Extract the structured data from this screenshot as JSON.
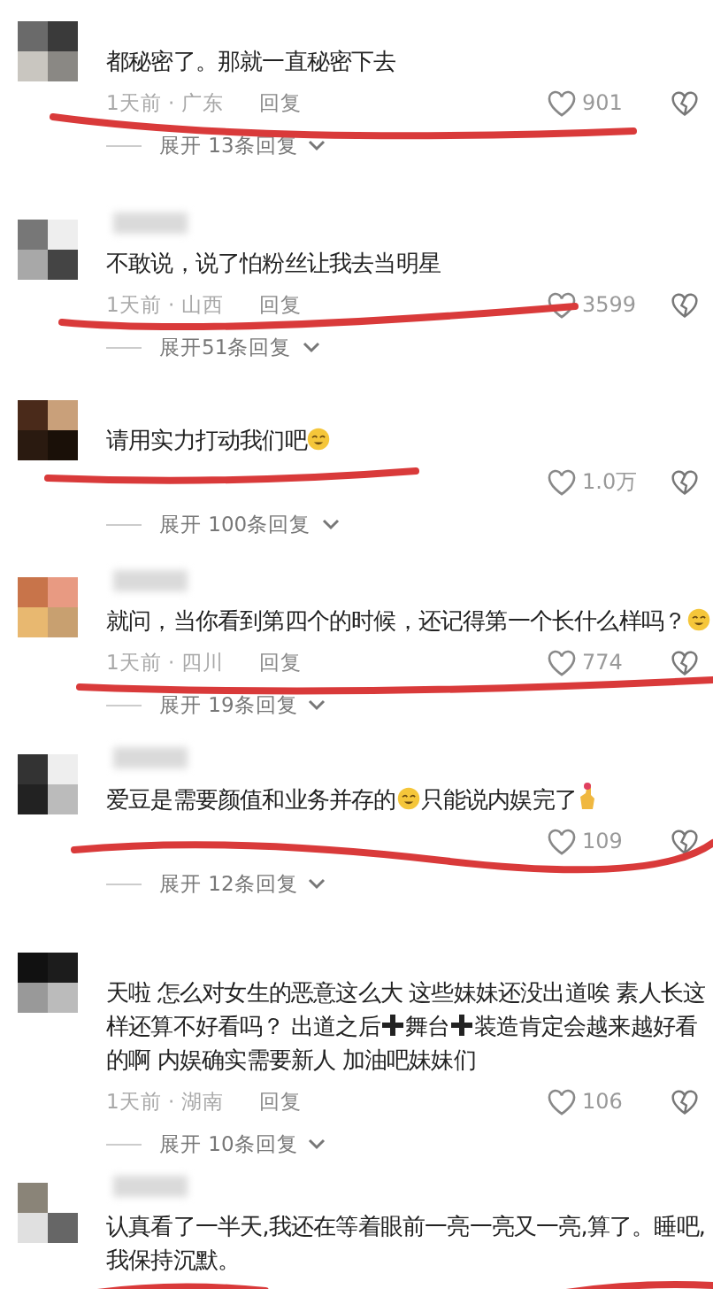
{
  "comments": [
    {
      "name_hidden": false,
      "parts": [
        {
          "kind": "text",
          "text": "都秘密了。那就一直秘密下去"
        }
      ],
      "meta": "1天前 · 广东",
      "reply": "回复",
      "likes": "901",
      "expand": "展开 13条回复"
    },
    {
      "name_hidden": true,
      "parts": [
        {
          "kind": "text",
          "text": "不敢说，说了怕粉丝让我去当明星"
        }
      ],
      "meta": "1天前 · 山西",
      "reply": "回复",
      "likes": "3599",
      "expand": "展开51条回复"
    },
    {
      "name_hidden": false,
      "parts": [
        {
          "kind": "text",
          "text": "请用实力打动我们吧"
        },
        {
          "kind": "emoji"
        }
      ],
      "likes": "1.0万",
      "expand": "展开 100条回复"
    },
    {
      "name_hidden": true,
      "parts": [
        {
          "kind": "text",
          "text": "就问，当你看到第四个的时候，还记得第一个长什么样吗？"
        },
        {
          "kind": "emoji"
        }
      ],
      "meta": "1天前 · 四川",
      "reply": "回复",
      "likes": "774",
      "expand": "展开 19条回复"
    },
    {
      "name_hidden": true,
      "parts": [
        {
          "kind": "text",
          "text": "爱豆是需要颜值和业务并存的"
        },
        {
          "kind": "emoji"
        },
        {
          "kind": "text",
          "text": "只能说内娱完了"
        },
        {
          "kind": "gesture"
        }
      ],
      "likes": "109",
      "expand": "展开 12条回复"
    },
    {
      "name_hidden": false,
      "parts": [
        {
          "kind": "text",
          "text": "天啦 怎么对女生的恶意这么大 这些妹妹还没出道唉 素人长这样还算不好看吗？ 出道之后"
        },
        {
          "kind": "plus"
        },
        {
          "kind": "text",
          "text": "舞台"
        },
        {
          "kind": "plus"
        },
        {
          "kind": "text",
          "text": "装造肯定会越来越好看的啊 内娱确实需要新人 加油吧妹妹们"
        }
      ],
      "meta": "1天前 · 湖南",
      "reply": "回复",
      "likes": "106",
      "expand": "展开 10条回复"
    },
    {
      "name_hidden": true,
      "parts": [
        {
          "kind": "text",
          "text": "认真看了一半天,我还在等着眼前一亮一亮又一亮,算了。睡吧,我保持沉默。"
        }
      ]
    }
  ]
}
